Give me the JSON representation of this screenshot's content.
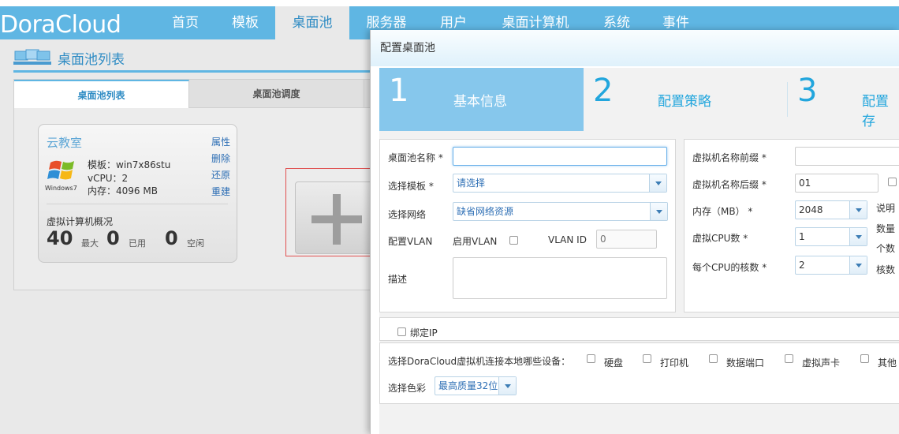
{
  "app": {
    "logo": "DoraCloud",
    "nav": [
      "首页",
      "模板",
      "桌面池",
      "服务器",
      "用户",
      "桌面计算机",
      "系统",
      "事件"
    ]
  },
  "page": {
    "title": "桌面池列表",
    "tabs": [
      "桌面池列表",
      "桌面池调度"
    ]
  },
  "pool_card": {
    "name": "云教室",
    "actions": [
      "属性",
      "删除",
      "还原",
      "重建"
    ],
    "os_label": "Windows7",
    "template": "模板：win7x86stu",
    "vcpu": "vCPU：2",
    "memory": "内存：4096 MB",
    "vm_overview_title": "虚拟计算机概况",
    "max_value": "40",
    "max_label": "最大",
    "used_value": "0",
    "used_label": "已用",
    "idle_value": "0",
    "idle_label": "空闲"
  },
  "modal": {
    "title": "配置桌面池",
    "steps": [
      {
        "num": "1",
        "label": "基本信息"
      },
      {
        "num": "2",
        "label": "配置策略"
      },
      {
        "num": "3",
        "label": "配置存"
      }
    ],
    "left_form": {
      "pool_name_label": "桌面池名称 *",
      "pool_name_value": "",
      "template_label": "选择模板 *",
      "template_value": "请选择",
      "network_label": "选择网络",
      "network_value": "缺省网络资源",
      "vlan_label": "配置VLAN",
      "enable_vlan_label": "启用VLAN",
      "vlan_id_label": "VLAN ID",
      "vlan_id_placeholder": "0",
      "desc_label": "描述"
    },
    "right_form": {
      "prefix_label": "虚拟机名称前缀 *",
      "prefix_value": "",
      "suffix_label": "虚拟机名称后缀 *",
      "suffix_value": "01",
      "memory_label": "内存（MB） *",
      "memory_value": "2048",
      "memory_note": "说明",
      "cpu_label": "虚拟CPU数 *",
      "cpu_value": "1",
      "cpu_note_1": "数量",
      "cpu_note_2": "个数",
      "cores_label": "每个CPU的核数 *",
      "cores_value": "2",
      "cores_note": "核数"
    },
    "bind_ip_label": "绑定IP",
    "devices": {
      "label": "选择DoraCloud虚拟机连接本地哪些设备：",
      "items": [
        "硬盘",
        "打印机",
        "数据端口",
        "虚拟声卡",
        "其他"
      ]
    },
    "color": {
      "label": "选择色彩",
      "value": "最高质量32位"
    }
  }
}
